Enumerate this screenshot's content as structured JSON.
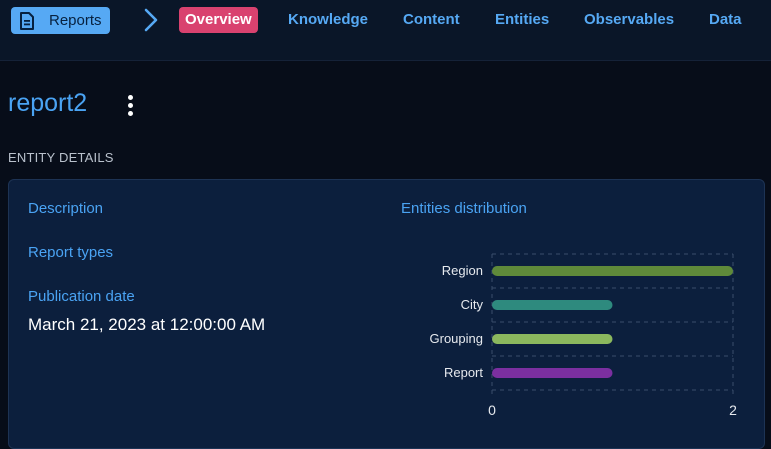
{
  "topbar": {
    "breadcrumb_label": "Reports",
    "tabs": [
      {
        "label": "Overview",
        "active": true
      },
      {
        "label": "Knowledge",
        "active": false
      },
      {
        "label": "Content",
        "active": false
      },
      {
        "label": "Entities",
        "active": false
      },
      {
        "label": "Observables",
        "active": false
      },
      {
        "label": "Data",
        "active": false
      }
    ]
  },
  "page": {
    "title": "report2",
    "section_label": "ENTITY DETAILS"
  },
  "details": {
    "description_label": "Description",
    "report_types_label": "Report types",
    "publication_date_label": "Publication date",
    "publication_date_value": "March 21, 2023 at 12:00:00 AM",
    "distribution_label": "Entities distribution"
  },
  "colors": {
    "accent": "#56a9f4",
    "active_tab": "#d9426f",
    "card_bg": "#0c1f3d"
  },
  "chart_data": {
    "type": "bar",
    "orientation": "horizontal",
    "categories": [
      "Region",
      "City",
      "Grouping",
      "Report"
    ],
    "values": [
      2,
      1,
      1,
      1
    ],
    "colors": [
      "#5f8a3a",
      "#2e8a7e",
      "#8bb85e",
      "#7b2fa0"
    ],
    "xlim": [
      0,
      2
    ],
    "xticks": [
      "0",
      "2"
    ],
    "grid": true
  }
}
